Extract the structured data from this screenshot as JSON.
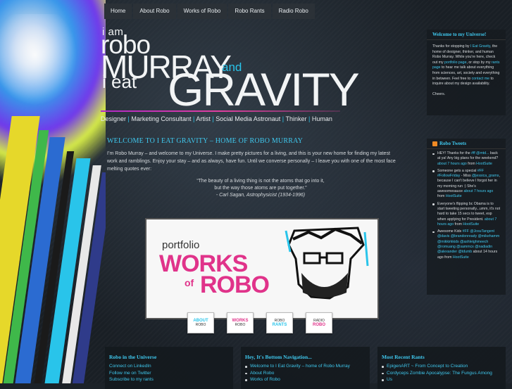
{
  "nav": {
    "items": [
      "Home",
      "About Robo",
      "Works of Robo",
      "Robo Rants",
      "Radio Robo"
    ]
  },
  "logo": {
    "iam": "i am",
    "robo": "robo",
    "murray": "MURRAY",
    "and": "and",
    "ieat": "i eat",
    "gravity": "GRAVITY"
  },
  "tagline": {
    "items": [
      "Designer",
      "Marketing Consultant",
      "Artist",
      "Social Media Astronaut",
      "Thinker",
      "Human"
    ],
    "separator": "|"
  },
  "post": {
    "title": "WELCOME TO I EAT GRAVITY – HOME OF ROBO MURRAY",
    "intro": "I’m Robo Murray – and welcome to my Universe. I make pretty pictures for a living, and this is your new home for finding my latest work and ramblings. Enjoy your stay – and as always, have fun. Until we converse personally – I leave you with one of the most face melting quotes ever:",
    "quote_line1": "“The beauty of a living thing is not the atoms that go into it,",
    "quote_line2": "but the way those atoms are put together.”",
    "quote_cite": "- Carl Sagan, Astrophysicist (1934-1996)"
  },
  "banner": {
    "portfolio": "portfolio",
    "works": "WORKS",
    "of": "of",
    "robo": "ROBO",
    "buttons": [
      {
        "line1": "ABOUT",
        "line2": "ROBO"
      },
      {
        "line1": "WORKS",
        "line2": "ROBO"
      },
      {
        "line1": "ROBO",
        "line2": "RANTS"
      },
      {
        "line1": "RADIO",
        "line2": "ROBO"
      }
    ]
  },
  "welcome_widget": {
    "title": "Welcome to my Universe!",
    "body_1": "Thanks for stopping by ",
    "link_1": "I Eat Gravity",
    "body_2": ", the home of designer, thinker, and human Robo Murray. While you’re here, check out my ",
    "link_2": "portfolio page",
    "body_3": ", or stop by my ",
    "link_3": "rants page",
    "body_4": " to hear me talk about everything from sciences, art, society and everything in between. Feel free to ",
    "link_4": "contact me",
    "body_5": " to inquire about my design availability.",
    "signoff": "Cheers."
  },
  "tweets_widget": {
    "title": "Robo Tweets",
    "tweets": [
      {
        "text": "HEY! Thanks for the ",
        "link1": "#ff @mtd...",
        "text2": " back at ya! Any big plans for the weekend? ",
        "time": "about 7 hours ago",
        "text3": " from ",
        "via": "HootSuite"
      },
      {
        "text": "Someone gets a special ",
        "link1": "#FF #FollowFriday",
        "text2": " - Miss ",
        "mention": "@jessica_grams",
        "text3": ", because I can't believe I forgot her in my morning run :) She's awesomesauce ",
        "time": "about 7 hours ago",
        "text4": " from ",
        "via": "HootSuite"
      },
      {
        "text": "Everyone's flipping bc Obama is to start tweeting personally...umm, it's not hard to take 15 secs to tweet, esp when applying for President. ",
        "time": "about 7 hours ago",
        "text2": " from ",
        "via": "HootSuite"
      },
      {
        "text": "Awesome Kids ",
        "link1": "#FF @JosuTangent @davis @brandonready @mikehamm @mikkirkkids @ashleighmeech @romuang @sammcx @nadiadin @alexander @tdumb",
        "text2": " about 14 hours ago from ",
        "via": "HootSuite"
      }
    ]
  },
  "bottom": {
    "col1": {
      "title": "Robo in the Universe",
      "links": [
        "Connect on LinkedIn",
        "Follow me on Twitter",
        "Subscribe to my rants"
      ]
    },
    "col2": {
      "title": "Hey, It's Bottom Navigation...",
      "links": [
        "Welcome to I Eat Gravity – home of Robo Murray",
        "About Robo",
        "Works of Robo"
      ]
    },
    "col3": {
      "title": "Most Recent Rants",
      "links": [
        "EpigenART ~ From Concept to Creation",
        "Cordyceps Zombie Apocalypse: The Fungus Among",
        "Us"
      ]
    }
  },
  "colors": {
    "accent_cyan": "#3fc8ee",
    "accent_pink": "#e0338a",
    "nav_bg": "#2b3137",
    "page_bg": "#1a2026"
  }
}
